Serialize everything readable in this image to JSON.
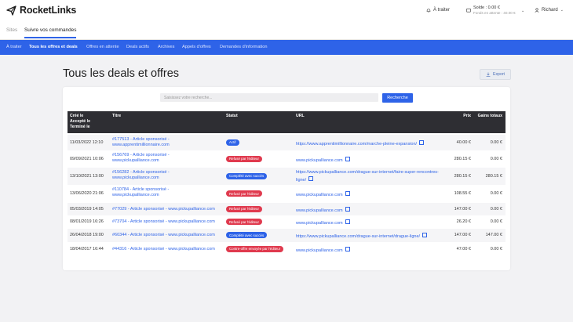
{
  "header": {
    "brand": "RocketLinks",
    "a_traiter": "À traiter",
    "solde": "Solde : 0.00 €",
    "solde_attente": "Fonds en attente : 40.00 €",
    "user": "Richard"
  },
  "subnav": {
    "sites": "Sites",
    "suivre": "Suivre vos commandes"
  },
  "bluenav": {
    "items": [
      "À traiter",
      "Tous les offres et deals",
      "Offres en attente",
      "Deals actifs",
      "Archives",
      "Appels d'offres",
      "Demandes d'information"
    ]
  },
  "page": {
    "title": "Tous les deals et offres",
    "export": "Export"
  },
  "search": {
    "placeholder": "Saisissez votre recherche...",
    "button": "Recherche"
  },
  "table": {
    "headers": {
      "created": "Créé le",
      "accepted": "Accepté le",
      "done": "Terminé le",
      "title": "Titre",
      "status": "Statut",
      "url": "URL",
      "prix": "Prix",
      "gains": "Gains totaux"
    },
    "rows": [
      {
        "date": "11/03/2022 12:10",
        "title1": "#177513 - Article sponsorisé -",
        "title2": "www.apprentimillionnaire.com",
        "status": "Actif",
        "status_color": "#2e63e8",
        "url1": "https://www.apprentimillionnaire.com/marche-pleine-expansion/",
        "url2": "",
        "prix": "40.00 €",
        "gain": "0.00 €"
      },
      {
        "date": "09/09/2021 10:06",
        "title1": "#156769 - Article sponsorisé -",
        "title2": "www.pickupalliance.com",
        "status": "Refusé par l'éditeur",
        "status_color": "#e03a4e",
        "url1": "www.pickupalliance.com",
        "url2": "",
        "prix": "280.15 €",
        "gain": "0.00 €"
      },
      {
        "date": "13/10/2021 13:00",
        "title1": "#156282 - Article sponsorisé -",
        "title2": "www.pickupalliance.com",
        "status": "Complété avec succès",
        "status_color": "#2e63e8",
        "url1": "https://www.pickupalliance.com/drague-sur-internet/faire-super-rencontres-",
        "url2": "ligne/",
        "prix": "280.15 €",
        "gain": "280.15 €"
      },
      {
        "date": "13/06/2020 21:06",
        "title1": "#110784 - Article sponsorisé -",
        "title2": "www.pickupalliance.com",
        "status": "Refusé par l'éditeur",
        "status_color": "#e03a4e",
        "url1": "www.pickupalliance.com",
        "url2": "",
        "prix": "108.55 €",
        "gain": "0.00 €"
      },
      {
        "date": "05/03/2019 14:05",
        "title1": "#77029 - Article sponsorisé - www.pickupalliance.com",
        "title2": "",
        "status": "Refusé par l'éditeur",
        "status_color": "#e03a4e",
        "url1": "www.pickupalliance.com",
        "url2": "",
        "prix": "147.00 €",
        "gain": "0.00 €"
      },
      {
        "date": "08/01/2019 16:26",
        "title1": "#73704 - Article sponsorisé - www.pickupalliance.com",
        "title2": "",
        "status": "Refusé par l'éditeur",
        "status_color": "#e03a4e",
        "url1": "www.pickupalliance.com",
        "url2": "",
        "prix": "26.20 €",
        "gain": "0.00 €"
      },
      {
        "date": "26/04/2018 19:00",
        "title1": "#60344 - Article sponsorisé - www.pickupalliance.com",
        "title2": "",
        "status": "Complété avec succès",
        "status_color": "#2e63e8",
        "url1": "https://www.pickupalliance.com/drague-sur-internet/drague-ligne/",
        "url2": "",
        "prix": "147.00 €",
        "gain": "147.00 €"
      },
      {
        "date": "18/04/2017 16:44",
        "title1": "#44316 - Article sponsorisé - www.pickupalliance.com",
        "title2": "",
        "status": "Contre-offre envoyée par l'éditeur",
        "status_color": "#e03a4e",
        "url1": "www.pickupalliance.com",
        "url2": "",
        "prix": "47.00 €",
        "gain": "0.00 €"
      }
    ]
  }
}
